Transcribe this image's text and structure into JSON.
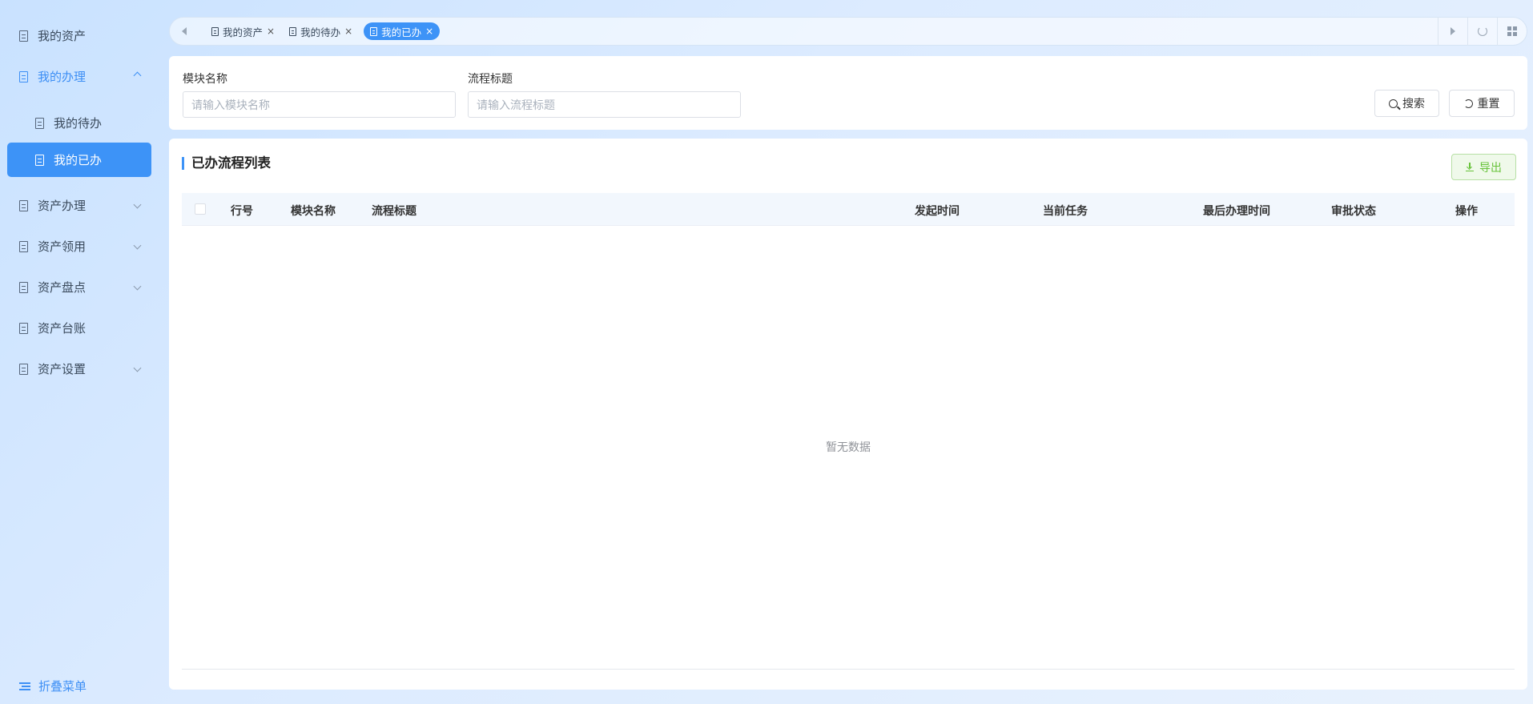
{
  "sidebar": {
    "items": [
      {
        "label": "我的资产"
      },
      {
        "label": "我的办理"
      },
      {
        "label": "我的待办"
      },
      {
        "label": "我的已办"
      },
      {
        "label": "资产办理"
      },
      {
        "label": "资产领用"
      },
      {
        "label": "资产盘点"
      },
      {
        "label": "资产台账"
      },
      {
        "label": "资产设置"
      }
    ],
    "collapse_label": "折叠菜单"
  },
  "tabs": [
    {
      "label": "我的资产",
      "close": "×"
    },
    {
      "label": "我的待办",
      "close": "×"
    },
    {
      "label": "我的已办",
      "close": "×"
    }
  ],
  "search": {
    "module_label": "模块名称",
    "module_placeholder": "请输入模块名称",
    "title_label": "流程标题",
    "title_placeholder": "请输入流程标题",
    "search_btn": "搜索",
    "reset_btn": "重置"
  },
  "list": {
    "title": "已办流程列表",
    "export_btn": "导出",
    "columns": [
      "行号",
      "模块名称",
      "流程标题",
      "发起时间",
      "当前任务",
      "最后办理时间",
      "审批状态",
      "操作"
    ],
    "empty_text": "暂无数据"
  },
  "colors": {
    "accent": "#3d93f7",
    "success": "#67c23a"
  }
}
